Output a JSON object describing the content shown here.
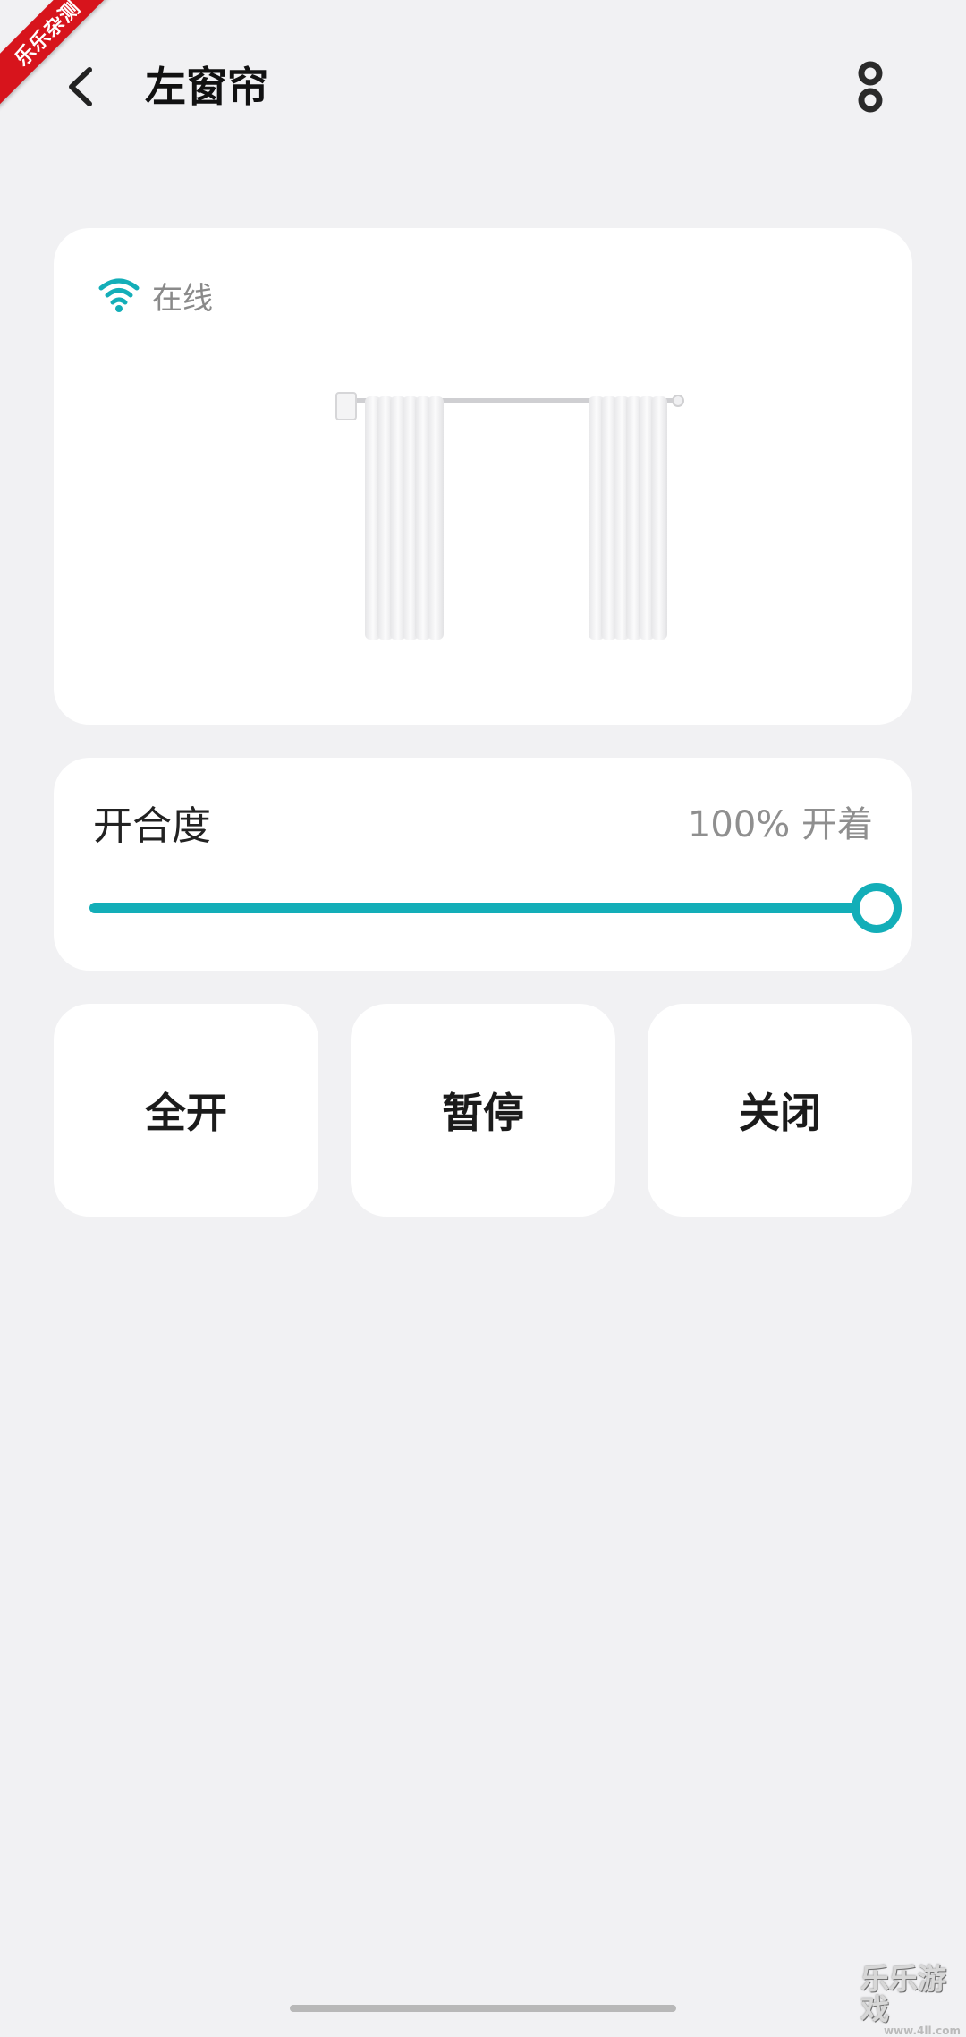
{
  "corner_badge": "乐乐杂测",
  "header": {
    "title": "左窗帘",
    "back_icon": "chevron-left-icon",
    "more_icon": "more-vertical-icon"
  },
  "status": {
    "icon": "wifi-icon",
    "text": "在线",
    "icon_color": "#13aeb8"
  },
  "opening": {
    "label": "开合度",
    "value_text": "100% 开着",
    "level_percent": 100,
    "accent_color": "#13aeb8"
  },
  "actions": {
    "open_all": "全开",
    "pause": "暂停",
    "close": "关闭"
  },
  "watermark": {
    "text": "乐乐游戏",
    "sub": "www.4ll.com"
  }
}
